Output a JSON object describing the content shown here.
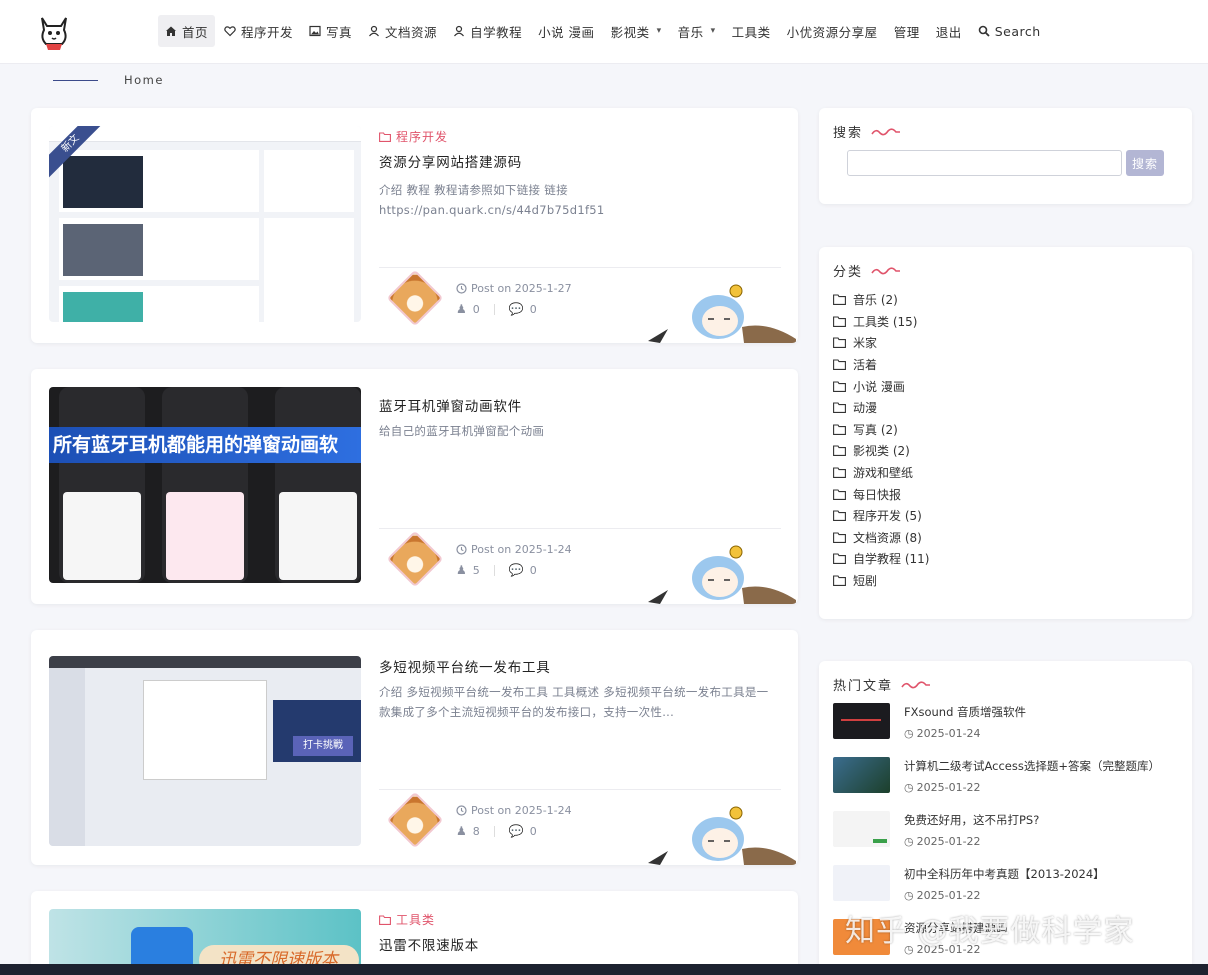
{
  "nav": {
    "items": [
      {
        "label": "首页",
        "icon": "home-icon"
      },
      {
        "label": "程序开发",
        "icon": "heart-icon"
      },
      {
        "label": "写真",
        "icon": "image-icon"
      },
      {
        "label": "文档资源",
        "icon": "user-icon"
      },
      {
        "label": "自学教程",
        "icon": "user-icon"
      },
      {
        "label": "小说 漫画"
      },
      {
        "label": "影视类"
      },
      {
        "label": "音乐"
      },
      {
        "label": "工具类"
      },
      {
        "label": "小优资源分享屋"
      },
      {
        "label": "管理"
      },
      {
        "label": "退出"
      },
      {
        "label": "Search",
        "icon": "search-icon"
      }
    ]
  },
  "breadcrumb": "Home",
  "posts": [
    {
      "category": "程序开发",
      "title": "资源分享网站搭建源码",
      "excerpt": "介绍 教程 教程请参照如下链接 链接 https://pan.quark.cn/s/44d7b75d1f51",
      "date": "Post on 2025-1-27",
      "views": "0",
      "comments": "0",
      "badge": "新文"
    },
    {
      "category": "",
      "title": "蓝牙耳机弹窗动画软件",
      "excerpt": "给自己的蓝牙耳机弹窗配个动画",
      "date": "Post on 2025-1-24",
      "views": "5",
      "comments": "0",
      "thumb_text": "所有蓝牙耳机都能用的弹窗动画软"
    },
    {
      "category": "",
      "title": "多短视频平台统一发布工具",
      "excerpt": "介绍 多短视频平台统一发布工具 工具概述 多短视频平台统一发布工具是一款集成了多个主流短视频平台的发布接口，支持一次性...",
      "date": "Post on 2025-1-24",
      "views": "8",
      "comments": "0",
      "thumb_text": "打卡挑戰"
    },
    {
      "category": "工具类",
      "title": "迅雷不限速版本",
      "thumb_text": "迅雷不限速版本"
    }
  ],
  "sidebar": {
    "search": {
      "title": "搜索",
      "button": "搜索",
      "placeholder": ""
    },
    "categories": {
      "title": "分类",
      "items": [
        "音乐 (2)",
        "工具类 (15)",
        "米家",
        "活着",
        "小说 漫画",
        "动漫",
        "写真 (2)",
        "影视类 (2)",
        "游戏和壁纸",
        "每日快报",
        "程序开发 (5)",
        "文档资源 (8)",
        "自学教程 (11)",
        "短剧"
      ]
    },
    "hot": {
      "title": "热门文章",
      "items": [
        {
          "title": "FXsound 音质增强软件",
          "date": "2025-01-24"
        },
        {
          "title": "计算机二级考试Access选择题+答案（完整题库）",
          "date": "2025-01-22"
        },
        {
          "title": "免费还好用，这不吊打PS?",
          "date": "2025-01-22"
        },
        {
          "title": "初中全科历年中考真题【2013-2024】",
          "date": "2025-01-22"
        },
        {
          "title": "资源分享站搭建源码",
          "date": "2025-01-22"
        }
      ]
    }
  },
  "watermark": "知乎 @我要做科学家",
  "colors": {
    "accent": "#e0546b",
    "button": "#b3b6d4",
    "nav_active": "#efeff2"
  }
}
